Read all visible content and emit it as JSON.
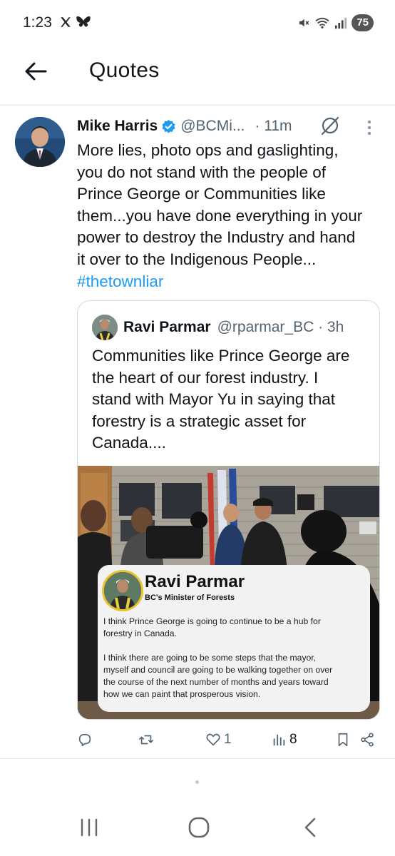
{
  "status_bar": {
    "time": "1:23",
    "battery": "75",
    "icons": [
      "x-icon",
      "bluesky-icon",
      "mute-icon",
      "wifi-icon",
      "signal-icon",
      "battery-icon"
    ]
  },
  "header": {
    "title": "Quotes",
    "back_icon": "arrow-left-icon"
  },
  "tweet": {
    "author_name": "Mike Harris",
    "handle": "@BCMi...",
    "time": "· 11m",
    "text": "More lies, photo ops and gaslighting,\nyou do not stand with the people of\nPrince George or Communities like\nthem...you have done everything in your\npower to destroy the Industry and hand\nit over to the Indigenous People...",
    "hashtag": "#thetownliar",
    "quoted": {
      "author_name": "Ravi Parmar",
      "handle": "@rparmar_BC · 3h",
      "text": "Communities like Prince George are\nthe heart of our forest industry. I\nstand with Mayor Yu in saying that\nforestry is a strategic asset for\nCanada....",
      "image_card": {
        "name": "Ravi Parmar",
        "role": "BC's Minister of Forests",
        "text": "I think Prince George is going to continue to be a hub for\nforestry in Canada.\n\nI think there are going to be some steps that the mayor,\nmyself and council are going to be walking together on over\nthe course of the next number of months and years toward\nhow we can paint that prosperous vision."
      }
    },
    "actions": {
      "reply_count": "",
      "retweet_count": "",
      "like_count": "1",
      "views_count": "8"
    }
  },
  "colors": {
    "link": "#1d9bf0",
    "secondary_text": "#536471",
    "border": "#cfd9de",
    "verified": "#1d9bf0"
  }
}
